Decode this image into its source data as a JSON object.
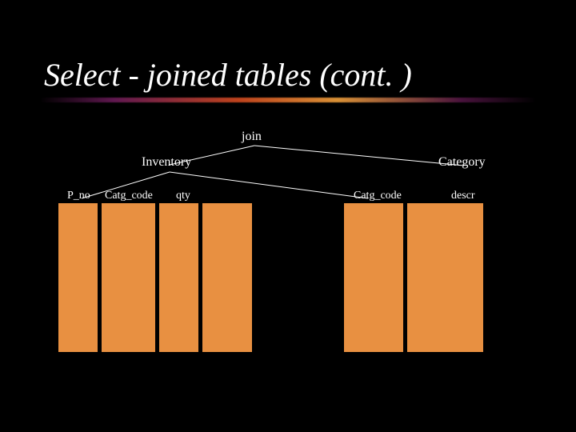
{
  "title": "Select - joined tables (cont. )",
  "join_label": "join",
  "left_table": {
    "name": "Inventory",
    "columns": [
      "P_no",
      "Catg_code",
      "qty"
    ]
  },
  "right_table": {
    "name": "Category",
    "columns": [
      "Catg_code",
      "descr"
    ]
  },
  "colors": {
    "background": "#000000",
    "text": "#ffffff",
    "table_fill": "#e89041"
  }
}
